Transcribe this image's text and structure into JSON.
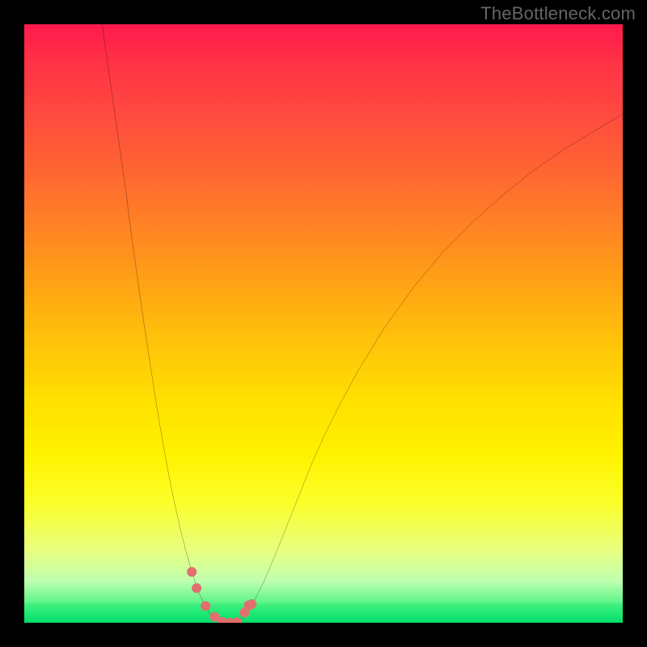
{
  "watermark": "TheBottleneck.com",
  "chart_data": {
    "type": "line",
    "title": "",
    "xlabel": "",
    "ylabel": "",
    "xlim": [
      0,
      100
    ],
    "ylim": [
      0,
      100
    ],
    "grid": false,
    "legend": false,
    "curve": {
      "x": [
        13,
        14,
        15,
        16,
        17,
        18,
        19,
        20,
        21,
        22,
        23,
        24,
        25,
        26,
        27,
        28,
        29,
        30,
        31,
        32,
        33,
        34,
        35,
        36,
        37,
        38,
        40,
        42,
        44,
        46,
        48,
        50,
        53,
        56,
        60,
        65,
        70,
        75,
        80,
        85,
        90,
        95,
        100
      ],
      "y": [
        100,
        93,
        86,
        79,
        72,
        64,
        57,
        50,
        43.5,
        37,
        31,
        25.5,
        20.5,
        16,
        12,
        8.5,
        5.5,
        3.2,
        1.6,
        0.6,
        0.15,
        0.02,
        0.05,
        0.4,
        1.3,
        2.8,
        6.8,
        11.5,
        16.5,
        21.5,
        26.5,
        31,
        37,
        42.5,
        49,
        56,
        62,
        67,
        71.5,
        75.5,
        79,
        82,
        85
      ]
    },
    "markers": {
      "x": [
        28.0,
        28.8,
        30.3,
        31.8,
        33.0,
        34.3,
        35.6,
        36.8,
        37.5,
        38.0
      ],
      "y": [
        8.5,
        5.8,
        2.8,
        1.0,
        0.15,
        0.02,
        0.12,
        1.7,
        2.9,
        3.1
      ],
      "color": "#e16f6f",
      "radius": 6
    },
    "gradient_stops": [
      {
        "pos": 0,
        "color": "#ff1a4d"
      },
      {
        "pos": 0.36,
        "color": "#ff8a20"
      },
      {
        "pos": 0.63,
        "color": "#ffe000"
      },
      {
        "pos": 0.88,
        "color": "#e8ff80"
      },
      {
        "pos": 1.0,
        "color": "#00dc6b"
      }
    ]
  }
}
